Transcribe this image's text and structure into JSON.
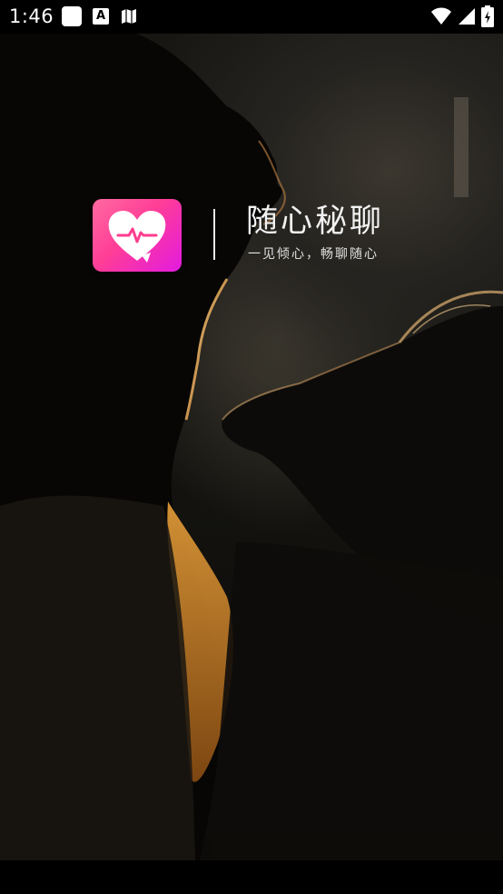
{
  "status_bar": {
    "time": "1:46",
    "left_icons": [
      "notification-square-icon",
      "notification-a-icon",
      "notification-map-icon"
    ],
    "right_icons": [
      "wifi-icon",
      "cellular-signal-icon",
      "battery-icon"
    ]
  },
  "splash": {
    "app_name": "随心秘聊",
    "slogan": "一见倾心，畅聊随心",
    "logo_icon": "heart-pulse-icon"
  },
  "colors": {
    "logo_gradient_start": "#ff6aa0",
    "logo_gradient_end": "#e21be0",
    "text": "#f2f2f2",
    "background": "#000000"
  }
}
